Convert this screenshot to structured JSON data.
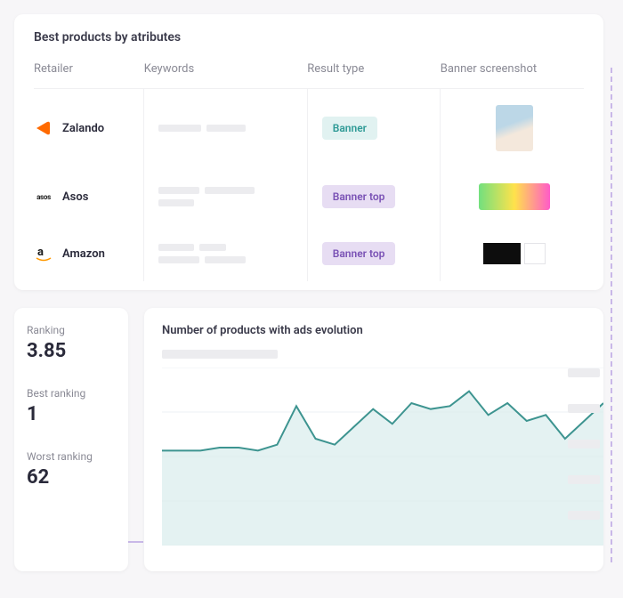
{
  "products": {
    "title": "Best products by atributes",
    "columns": [
      "Retailer",
      "Keywords",
      "Result type",
      "Banner screenshot"
    ],
    "rows": [
      {
        "retailer": "Zalando",
        "badge": "Banner",
        "badge_variant": "teal"
      },
      {
        "retailer": "Asos",
        "badge": "Banner top",
        "badge_variant": "purple"
      },
      {
        "retailer": "Amazon",
        "badge": "Banner top",
        "badge_variant": "purple"
      }
    ]
  },
  "rankings": {
    "ranking_label": "Ranking",
    "ranking_value": "3.85",
    "best_label": "Best ranking",
    "best_value": "1",
    "worst_label": "Worst ranking",
    "worst_value": "62"
  },
  "chart": {
    "title": "Number of products with ads evolution"
  },
  "chart_data": {
    "type": "area",
    "title": "Number of products with ads evolution",
    "xlabel": "",
    "ylabel": "",
    "x": [
      0,
      1,
      2,
      3,
      4,
      5,
      6,
      7,
      8,
      9,
      10,
      11,
      12,
      13,
      14,
      15,
      16,
      17,
      18,
      19,
      20,
      21,
      22,
      23
    ],
    "values": [
      32,
      32,
      32,
      33,
      33,
      32,
      34,
      47,
      36,
      34,
      40,
      46,
      41,
      48,
      46,
      47,
      52,
      44,
      48,
      42,
      44,
      36,
      42,
      48
    ],
    "ylim": [
      0,
      60
    ],
    "grid": true
  },
  "colors": {
    "teal_badge_bg": "#e1f2f1",
    "teal_badge_fg": "#2e9a96",
    "purple_badge_bg": "#e7ddf3",
    "purple_badge_fg": "#7a52b5",
    "chart_line": "#3d9490",
    "chart_area": "#d9ecec"
  }
}
